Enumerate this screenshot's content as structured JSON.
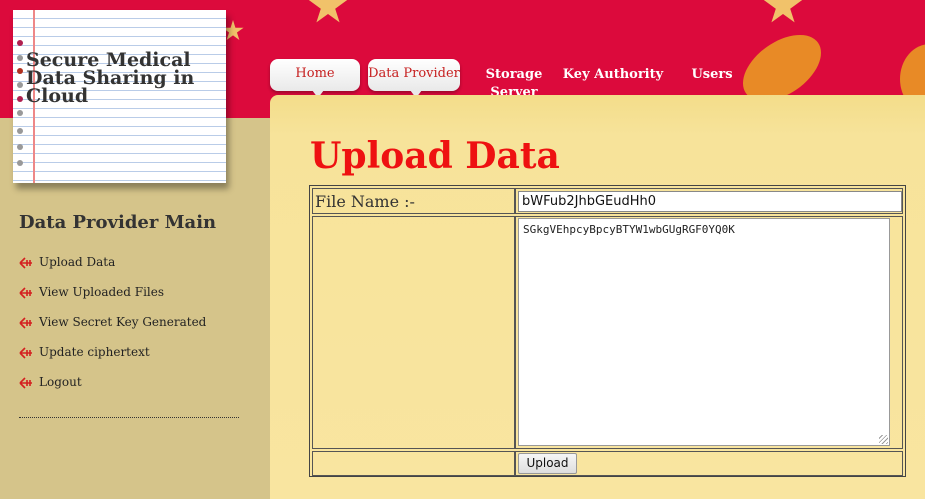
{
  "site": {
    "title": "Secure Medical Data Sharing in Cloud"
  },
  "nav": {
    "items": [
      {
        "label": "Home"
      },
      {
        "label": "Data Provider"
      },
      {
        "label": "Storage Server"
      },
      {
        "label": "Key Authority"
      },
      {
        "label": "Users"
      }
    ]
  },
  "sidebar": {
    "title": "Data Provider Main",
    "items": [
      {
        "label": "Upload Data"
      },
      {
        "label": "View Uploaded Files"
      },
      {
        "label": "View Secret Key Generated"
      },
      {
        "label": "Update ciphertext"
      },
      {
        "label": "Logout"
      }
    ]
  },
  "main": {
    "title": "Upload Data",
    "form": {
      "filename_label": "File Name :-",
      "filename_value": "bWFub2JhbGEudHh0",
      "content_value": "SGkgVEhpcyBpcyBTYW1wbGUgRGF0YQ0K",
      "upload_label": "Upload"
    }
  },
  "colors": {
    "header_red": "#dc0a3c",
    "title_red": "#ee1111",
    "panel_yellow": "#f7e39a",
    "sidebar_tan": "#d5c48a"
  }
}
